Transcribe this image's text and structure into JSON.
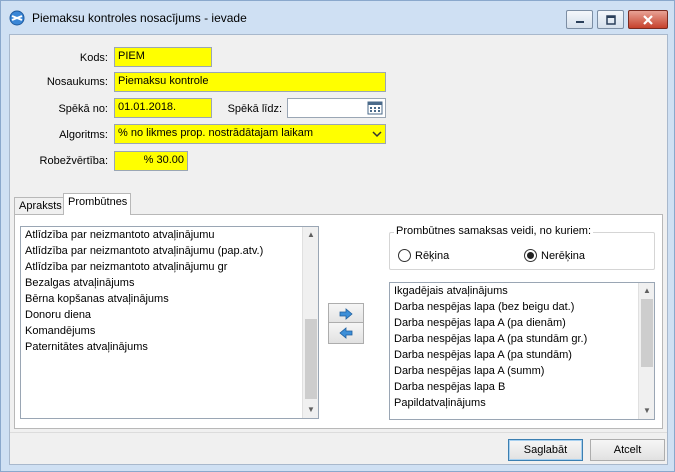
{
  "window": {
    "title": "Piemaksu kontroles nosacījums - ievade",
    "app_icon": "app-globe-icon",
    "title_bar_color": "#cfe0f3"
  },
  "form": {
    "kods": {
      "label": "Kods:",
      "value": "PIEM"
    },
    "nosaukums": {
      "label": "Nosaukums:",
      "value": "Piemaksu kontrole"
    },
    "speka_no": {
      "label": "Spēkā no:",
      "value": "01.01.2018."
    },
    "speka_lidz": {
      "label": "Spēkā līdz:",
      "value": ""
    },
    "algoritms": {
      "label": "Algoritms:",
      "value": "% no likmes prop. nostrādātajam laikam"
    },
    "robezvertiba": {
      "label": "Robežvērtība:",
      "value": "% 30.00"
    },
    "highlight_color": "#ffff00"
  },
  "tabs": [
    {
      "label": "Apraksts",
      "active": false
    },
    {
      "label": "Prombūtnes",
      "active": true
    }
  ],
  "prombutnes": {
    "available_list": [
      "Atlīdzība par neizmantoto atvaļinājumu",
      "Atlīdzība par neizmantoto atvaļinājumu (pap.atv.)",
      "Atlīdzība par neizmantoto atvaļinājumu gr",
      "Bezalgas atvaļinājums",
      "Bērna kopšanas atvaļinājums",
      "Donoru diena",
      "Komandējums",
      "Paternitātes atvaļinājums"
    ],
    "group_title": "Prombūtnes samaksas veidi, no kuriem:",
    "radio_options": [
      {
        "label": "Rēķina",
        "selected": false
      },
      {
        "label": "Nerēķina",
        "selected": true
      }
    ],
    "selected_list": [
      "Ikgadējais atvaļinājums",
      "Darba nespējas lapa  (bez beigu dat.)",
      "Darba nespējas lapa  A (pa dienām)",
      "Darba nespējas lapa  A (pa stundām gr.)",
      "Darba nespējas lapa  A (pa stundām)",
      "Darba nespējas lapa  A (summ)",
      "Darba nespējas lapa  B",
      "Papildatvaļinājums"
    ],
    "arrow_right_icon": "arrow-right-icon",
    "arrow_left_icon": "arrow-left-icon"
  },
  "footer": {
    "save_label": "Saglabāt",
    "cancel_label": "Atcelt"
  }
}
